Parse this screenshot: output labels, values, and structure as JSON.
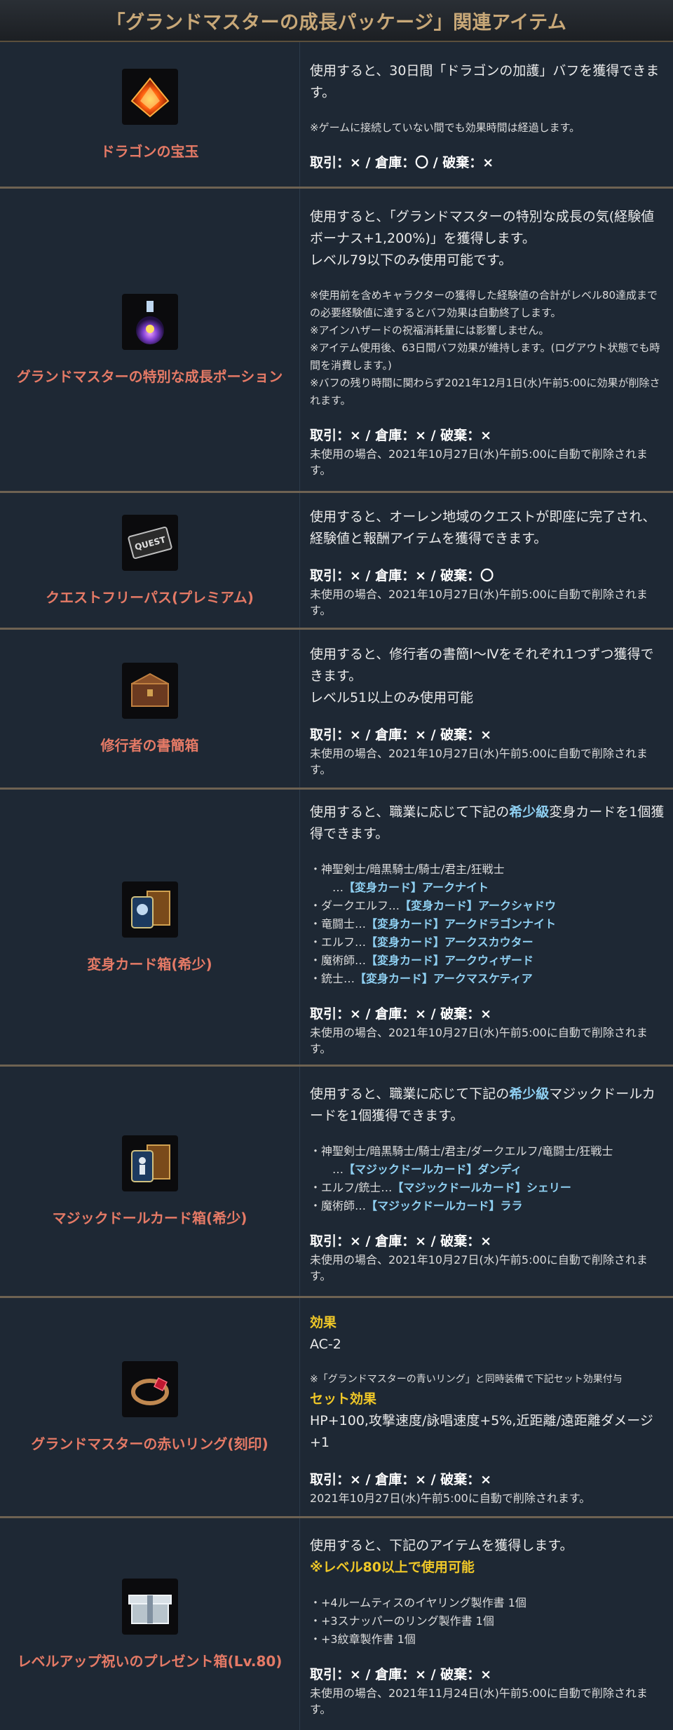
{
  "header": {
    "title": "「グランドマスターの成長パッケージ」関連アイテム"
  },
  "items": [
    {
      "name": "ドラゴンの宝玉",
      "icon": "dragon-gem-icon",
      "desc": [
        "使用すると、30日間「ドラゴンの加護」バフを獲得できます。"
      ],
      "notes": [
        "※ゲームに接続していない間でも効果時間は経過します。"
      ],
      "trade": "取引：× / 倉庫：〇 / 破棄：×"
    },
    {
      "name": "グランドマスターの特別な成長ポーション",
      "icon": "growth-potion-icon",
      "desc": [
        "使用すると、「グランドマスターの特別な成長の気(経験値ボーナス+1,200%)」を獲得します。",
        "レベル79以下のみ使用可能です。"
      ],
      "notes": [
        "※使用前を含めキャラクターの獲得した経験値の合計がレベル80達成までの必要経験値に達するとバフ効果は自動終了します。",
        "※アインハザードの祝福消耗量には影響しません。",
        "※アイテム使用後、63日間バフ効果が維持します。(ログアウト状態でも時間を消費します。)",
        "※バフの残り時間に関わらず2021年12月1日(水)午前5:00に効果が削除されます。"
      ],
      "trade": "取引：× / 倉庫：× / 破棄：×",
      "expire": "未使用の場合、2021年10月27日(水)午前5:00に自動で削除されます。"
    },
    {
      "name": "クエストフリーパス(プレミアム)",
      "icon": "quest-pass-icon",
      "icon_text": "QUEST",
      "desc": [
        "使用すると、オーレン地域のクエストが即座に完了され、経験値と報酬アイテムを獲得できます。"
      ],
      "trade": "取引：× / 倉庫：× / 破棄：〇",
      "expire": "未使用の場合、2021年10月27日(水)午前5:00に自動で削除されます。"
    },
    {
      "name": "修行者の書簡箱",
      "icon": "letter-box-icon",
      "desc": [
        "使用すると、修行者の書簡Ⅰ～Ⅳをそれぞれ1つずつ獲得できます。",
        "レベル51以上のみ使用可能"
      ],
      "trade": "取引：× / 倉庫：× / 破棄：×",
      "expire": "未使用の場合、2021年10月27日(水)午前5:00に自動で削除されます。"
    },
    {
      "name": "変身カード箱(希少)",
      "icon": "transform-card-box-icon",
      "desc_parts": {
        "before": "使用すると、職業に応じて下記の",
        "highlight": "希少級",
        "after": "変身カードを1個獲得できます。"
      },
      "lines": [
        {
          "prefix": "・神聖剣士/暗黒騎士/騎士/君主/狂戦士",
          "card": ""
        },
        {
          "prefix": "　…",
          "card": "【変身カード】アークナイト",
          "indent": true
        },
        {
          "prefix": "・ダークエルフ…",
          "card": "【変身カード】アークシャドウ"
        },
        {
          "prefix": "・竜闘士…",
          "card": "【変身カード】アークドラゴンナイト"
        },
        {
          "prefix": "・エルフ…",
          "card": "【変身カード】アークスカウター"
        },
        {
          "prefix": "・魔術師…",
          "card": "【変身カード】アークウィザード"
        },
        {
          "prefix": "・銃士…",
          "card": "【変身カード】アークマスケティア"
        }
      ],
      "trade": "取引：× / 倉庫：× / 破棄：×",
      "expire": "未使用の場合、2021年10月27日(水)午前5:00に自動で削除されます。"
    },
    {
      "name": "マジックドールカード箱(希少)",
      "icon": "magic-doll-card-box-icon",
      "desc_parts": {
        "before": "使用すると、職業に応じて下記の",
        "highlight": "希少級",
        "after": "マジックドールカードを1個獲得できます。"
      },
      "lines": [
        {
          "prefix": "・神聖剣士/暗黒騎士/騎士/君主/ダークエルフ/竜闘士/狂戦士",
          "card": ""
        },
        {
          "prefix": "　…",
          "card": "【マジックドールカード】ダンディ",
          "indent": true
        },
        {
          "prefix": "・エルフ/銃士…",
          "card": "【マジックドールカード】シェリー"
        },
        {
          "prefix": "・魔術師…",
          "card": "【マジックドールカード】ララ"
        }
      ],
      "trade": "取引：× / 倉庫：× / 破棄：×",
      "expire": "未使用の場合、2021年10月27日(水)午前5:00に自動で削除されます。"
    },
    {
      "name": "グランドマスターの赤いリング(刻印)",
      "icon": "red-ring-icon",
      "effect_label": "効果",
      "effect_value": "AC-2",
      "set_note": "※「グランドマスターの青いリング」と同時装備で下記セット効果付与",
      "set_label": "セット効果",
      "set_value": "HP+100,攻撃速度/詠唱速度+5%,近距離/遠距離ダメージ+1",
      "trade": "取引：× / 倉庫：× / 破棄：×",
      "expire": "2021年10月27日(水)午前5:00に自動で削除されます。"
    },
    {
      "name": "レベルアップ祝いのプレゼント箱(Lv.80)",
      "icon": "present-box-icon",
      "desc": [
        "使用すると、下記のアイテムを獲得します。"
      ],
      "requirement": "※レベル80以上で使用可能",
      "contents": [
        "・+4ルームティスのイヤリング製作書 1個",
        "・+3スナッパーのリング製作書 1個",
        "・+3紋章製作書 1個"
      ],
      "trade": "取引：× / 倉庫：× / 破棄：×",
      "expire": "未使用の場合、2021年11月24日(水)午前5:00に自動で削除されます。"
    }
  ]
}
